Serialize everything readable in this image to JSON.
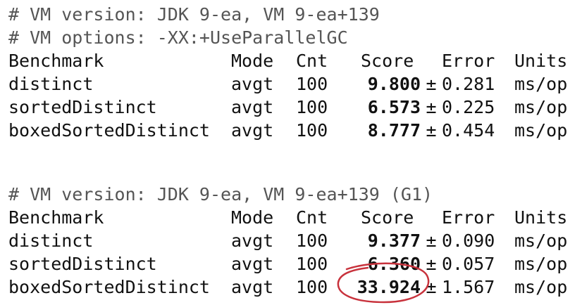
{
  "block1": {
    "comment_lines": [
      "# VM version: JDK 9-ea, VM 9-ea+139",
      "# VM options: -XX:+UseParallelGC"
    ],
    "headers": [
      "Benchmark",
      "Mode",
      "Cnt",
      "Score",
      "Error",
      "Units"
    ],
    "rows": [
      {
        "benchmark": "distinct",
        "mode": "avgt",
        "cnt": "100",
        "score": "9.800",
        "pm": "±",
        "error": "0.281",
        "units": "ms/op"
      },
      {
        "benchmark": "sortedDistinct",
        "mode": "avgt",
        "cnt": "100",
        "score": "6.573",
        "pm": "±",
        "error": "0.225",
        "units": "ms/op"
      },
      {
        "benchmark": "boxedSortedDistinct",
        "mode": "avgt",
        "cnt": "100",
        "score": "8.777",
        "pm": "±",
        "error": "0.454",
        "units": "ms/op"
      }
    ]
  },
  "block2": {
    "comment_lines": [
      "# VM version: JDK 9-ea, VM 9-ea+139 (G1)"
    ],
    "headers": [
      "Benchmark",
      "Mode",
      "Cnt",
      "Score",
      "Error",
      "Units"
    ],
    "rows": [
      {
        "benchmark": "distinct",
        "mode": "avgt",
        "cnt": "100",
        "score": "9.377",
        "pm": "±",
        "error": "0.090",
        "units": "ms/op"
      },
      {
        "benchmark": "sortedDistinct",
        "mode": "avgt",
        "cnt": "100",
        "score": "6.360",
        "pm": "±",
        "error": "0.057",
        "units": "ms/op"
      },
      {
        "benchmark": "boxedSortedDistinct",
        "mode": "avgt",
        "cnt": "100",
        "score": "33.924",
        "pm": "±",
        "error": "1.567",
        "units": "ms/op"
      }
    ]
  },
  "annotation": {
    "color": "#c8323c",
    "shape": "hand-drawn circle around 33.924"
  }
}
